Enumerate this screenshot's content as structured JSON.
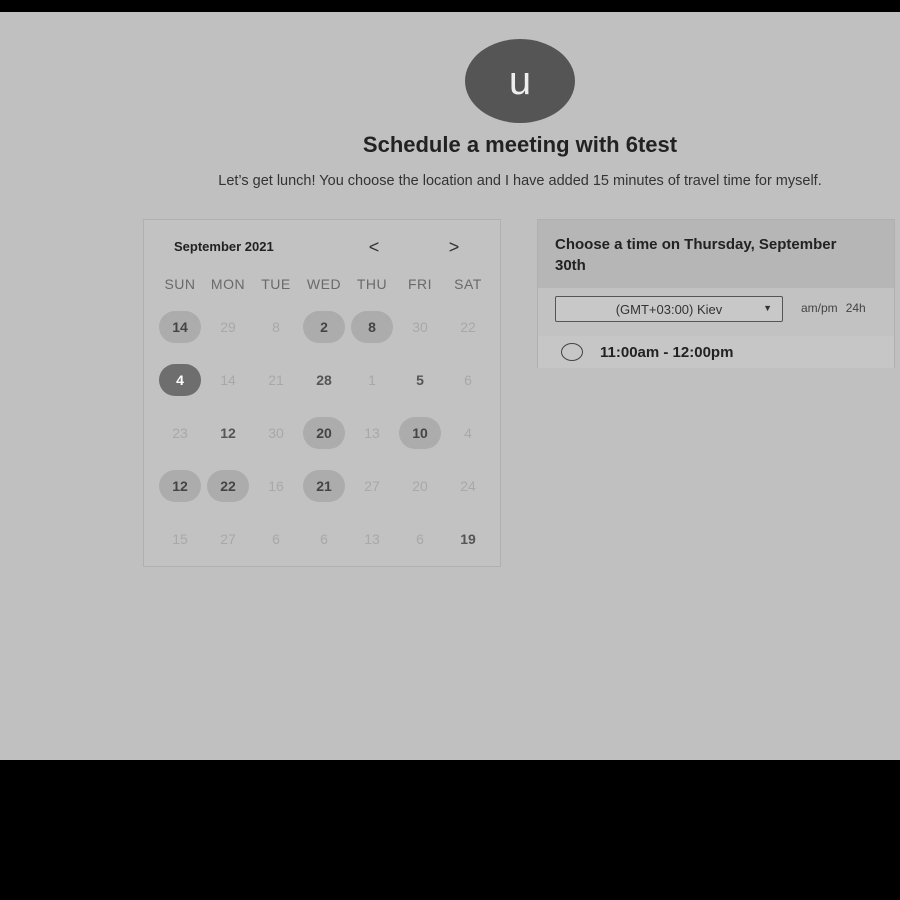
{
  "avatar": {
    "letter": "u"
  },
  "header": {
    "title": "Schedule a meeting with 6test",
    "subtitle": "Let’s get lunch! You choose the location and I have added 15 minutes of travel time for myself."
  },
  "calendar": {
    "month": "September 2021",
    "prev_icon": "<",
    "next_icon": ">",
    "weekdays": [
      "SUN",
      "MON",
      "TUE",
      "WED",
      "THU",
      "FRI",
      "SAT"
    ],
    "weeks": [
      [
        {
          "d": "14",
          "s": "avail"
        },
        {
          "d": "29",
          "s": "muted"
        },
        {
          "d": "8",
          "s": "muted"
        },
        {
          "d": "2",
          "s": "avail"
        },
        {
          "d": "8",
          "s": "avail"
        },
        {
          "d": "30",
          "s": "muted"
        },
        {
          "d": "22",
          "s": "muted"
        }
      ],
      [
        {
          "d": "4",
          "s": "selected"
        },
        {
          "d": "14",
          "s": "muted"
        },
        {
          "d": "21",
          "s": "muted"
        },
        {
          "d": "28",
          "s": "normal"
        },
        {
          "d": "1",
          "s": "muted"
        },
        {
          "d": "5",
          "s": "normal"
        },
        {
          "d": "6",
          "s": "muted"
        }
      ],
      [
        {
          "d": "23",
          "s": "muted"
        },
        {
          "d": "12",
          "s": "normal"
        },
        {
          "d": "30",
          "s": "muted"
        },
        {
          "d": "20",
          "s": "avail"
        },
        {
          "d": "13",
          "s": "muted"
        },
        {
          "d": "10",
          "s": "avail"
        },
        {
          "d": "4",
          "s": "muted"
        }
      ],
      [
        {
          "d": "12",
          "s": "avail"
        },
        {
          "d": "22",
          "s": "avail"
        },
        {
          "d": "16",
          "s": "muted"
        },
        {
          "d": "21",
          "s": "avail"
        },
        {
          "d": "27",
          "s": "muted"
        },
        {
          "d": "20",
          "s": "muted"
        },
        {
          "d": "24",
          "s": "muted"
        }
      ],
      [
        {
          "d": "15",
          "s": "muted"
        },
        {
          "d": "27",
          "s": "muted"
        },
        {
          "d": "6",
          "s": "muted"
        },
        {
          "d": "6",
          "s": "muted"
        },
        {
          "d": "13",
          "s": "muted"
        },
        {
          "d": "6",
          "s": "muted"
        },
        {
          "d": "19",
          "s": "normal"
        }
      ]
    ]
  },
  "panel": {
    "title": "Choose a time on Thursday, September 30th",
    "timezone": "(GMT+03:00) Kiev",
    "format_ampm": "am/pm",
    "format_24h": "24h",
    "slots": [
      "11:00am - 12:00pm"
    ]
  },
  "colors": {
    "background": "#c0c0c0",
    "avatar": "#555555",
    "selected_day": "#6e6e6e",
    "available_day": "#acacac"
  }
}
